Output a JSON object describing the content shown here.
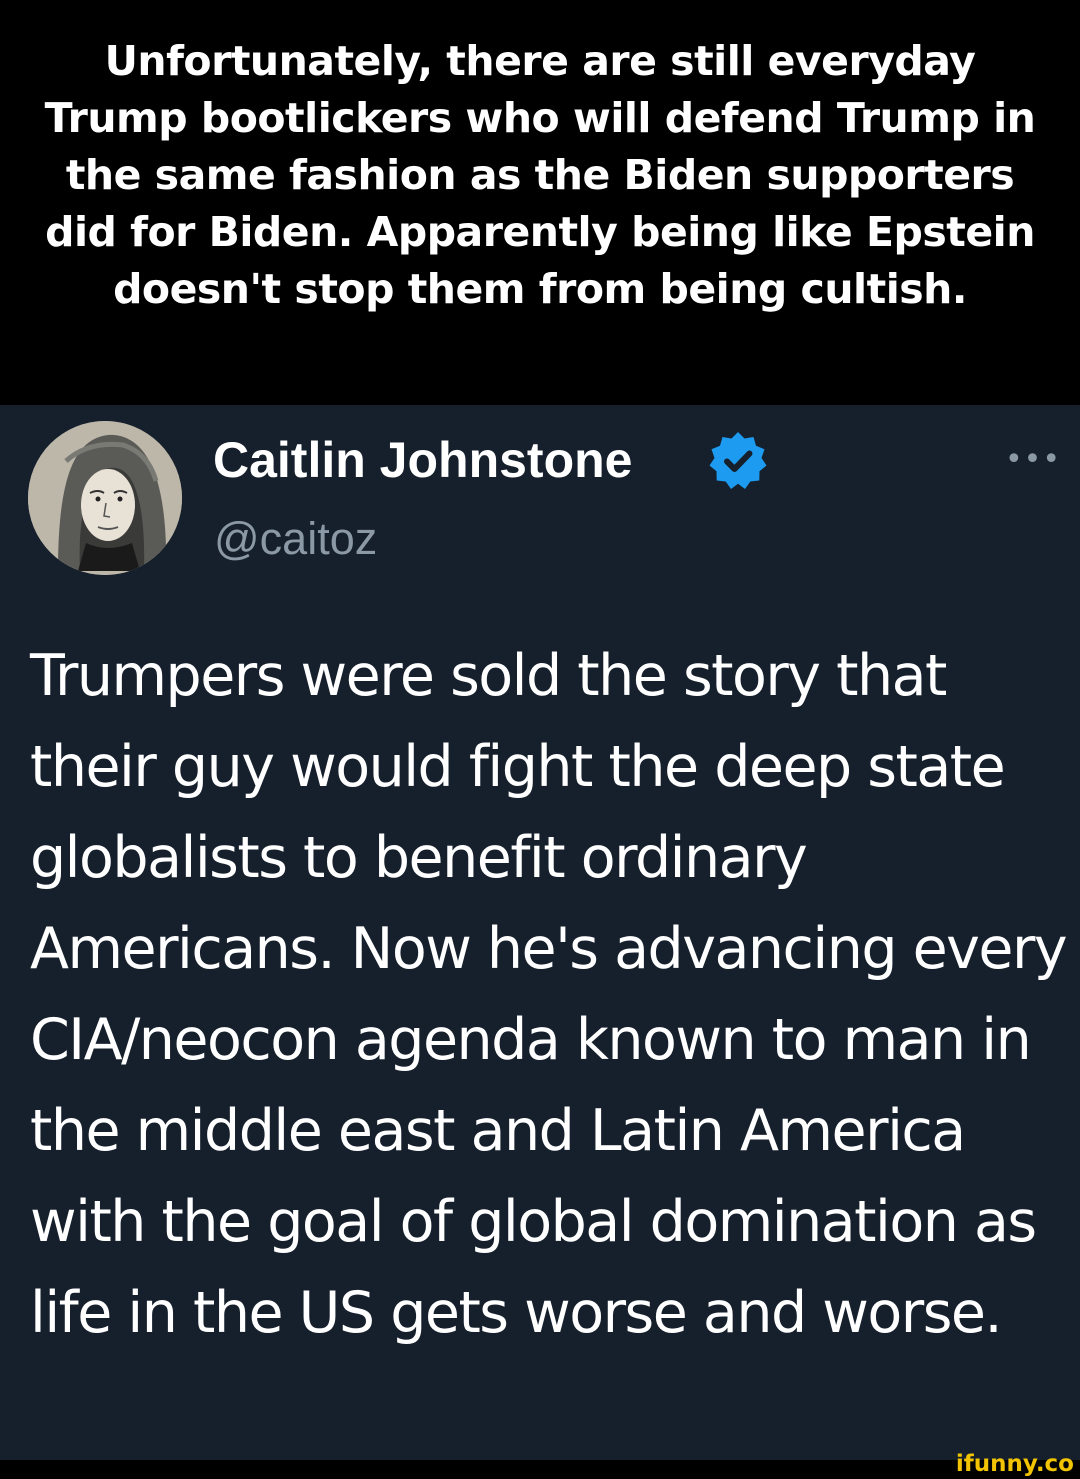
{
  "caption": {
    "text": "Unfortunately, there are still everyday Trump bootlickers who will defend Trump in the same fashion as the Biden supporters did for Biden. Apparently being like Epstein doesn't stop them from being cultish."
  },
  "tweet": {
    "author": {
      "display_name": "Caitlin Johnstone",
      "handle": "@caitoz",
      "verified": true
    },
    "more_icon": "more-options-icon",
    "more_glyph": "•••",
    "text": "Trumpers were sold the story that their guy would fight the deep state globalists to benefit ordinary Americans. Now he's advancing every CIA/neocon agenda known to man in the middle east and Latin America with the goal of global domination as life in the US gets worse and worse."
  },
  "watermark": {
    "text": "ifunny.co"
  },
  "colors": {
    "caption_background": "#000000",
    "caption_text": "#ffffff",
    "tweet_background": "#16202c",
    "tweet_text": "#ffffff",
    "handle_text": "#8b98a5",
    "verified_badge": "#1d9bf0",
    "watermark": "#f2c300"
  }
}
